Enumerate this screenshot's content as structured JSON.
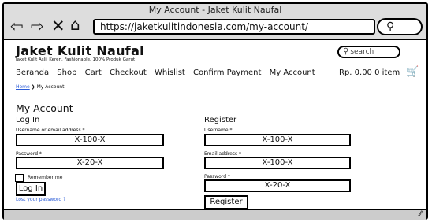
{
  "window": {
    "title": "My Account - Jaket Kulit Naufal"
  },
  "browser": {
    "url": "https://jaketkulitindonesia.com/my-account/",
    "icons": [
      "back-arrow-icon",
      "forward-arrow-icon",
      "close-icon",
      "home-icon",
      "search-icon"
    ]
  },
  "site": {
    "brand": "Jaket Kulit Naufal",
    "tagline": "Jaket Kulit Asli, Keren, Fashionable, 100% Produk Garut",
    "search_placeholder": "search"
  },
  "nav": {
    "items": [
      "Beranda",
      "Shop",
      "Cart",
      "Checkout",
      "Whislist",
      "Confirm Payment",
      "My Account"
    ]
  },
  "cart": {
    "summary": "Rp. 0.00  0 item"
  },
  "breadcrumb": {
    "home": "Home",
    "separator": "❯",
    "current": "My Account"
  },
  "page": {
    "title": "My Account"
  },
  "login": {
    "title": "Log In",
    "username_label": "Username or email address *",
    "username_value": "X-100-X",
    "password_label": "Password *",
    "password_value": "X-20-X",
    "remember_label": "Remember me",
    "button": "Log In",
    "lost_password": "Lost your password ?"
  },
  "register": {
    "title": "Register",
    "username_label": "Username *",
    "username_value": "X-100-X",
    "email_label": "Email address *",
    "email_value": "X-100-X",
    "password_label": "Password *",
    "password_value": "X-20-X",
    "button": "Register"
  }
}
